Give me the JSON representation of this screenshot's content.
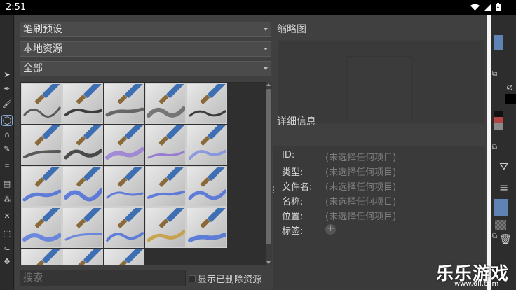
{
  "status_bar": {
    "time": "2:51",
    "icons": [
      "wifi-icon",
      "signal-icon",
      "battery-icon"
    ]
  },
  "left_toolbar": {
    "tools": [
      "select-arrow-icon",
      "pen-nib-icon",
      "brush-icon",
      "ellipse-icon",
      "path-icon",
      "calligraphy-icon",
      "crop-icon",
      "gradient-icon",
      "fill-icon",
      "transform-icon",
      "rect-select-icon",
      "lasso-icon",
      "move-icon"
    ]
  },
  "resource_panel": {
    "filter_type": "笔刷预设",
    "filter_origin": "本地资源",
    "filter_tag": "全部",
    "search_placeholder": "搜索",
    "show_deleted_label": "显示已删除资源",
    "tiles": [
      {
        "name": "eraser-brush-preset"
      },
      {
        "name": "ink-pen-brush-preset"
      },
      {
        "name": "pencil-brush-preset"
      },
      {
        "name": "sketch-pencil-brush-preset"
      },
      {
        "name": "hatching-pen-brush-preset"
      },
      {
        "name": "marker-gray-brush-preset"
      },
      {
        "name": "marker-dark-brush-preset"
      },
      {
        "name": "palette-knife-brush-preset"
      },
      {
        "name": "wet-brush-purple-preset"
      },
      {
        "name": "airbrush-purple-preset"
      },
      {
        "name": "watercolor-blue-1-preset"
      },
      {
        "name": "watercolor-blue-2-preset"
      },
      {
        "name": "bristle-blue-1-preset"
      },
      {
        "name": "bristle-blue-2-preset"
      },
      {
        "name": "bristle-blue-3-preset"
      },
      {
        "name": "flat-brush-smudge-1-preset"
      },
      {
        "name": "flat-brush-smudge-2-preset"
      },
      {
        "name": "spray-texture-preset"
      },
      {
        "name": "sponge-texture-preset"
      },
      {
        "name": "blender-blue-preset"
      },
      {
        "name": "filbert-brush-preset"
      },
      {
        "name": "liner-brush-preset"
      },
      {
        "name": "water-drop-preset"
      }
    ]
  },
  "preview_panel": {
    "title": "缩略图"
  },
  "details_panel": {
    "title": "详细信息",
    "rows": [
      {
        "label": "ID:",
        "value": "(未选择任何项目)"
      },
      {
        "label": "类型:",
        "value": "(未选择任何项目)"
      },
      {
        "label": "文件名:",
        "value": "(未选择任何项目)"
      },
      {
        "label": "名称:",
        "value": "(未选择任何项目)"
      },
      {
        "label": "位置:",
        "value": "(未选择任何项目)"
      },
      {
        "label": "标签:",
        "value": ""
      }
    ]
  },
  "watermark": {
    "text": "乐乐游戏",
    "url": "www.6ll.com"
  },
  "colors": {
    "dialog_bg": "#404040",
    "accent_blue": "#5e83b4"
  }
}
